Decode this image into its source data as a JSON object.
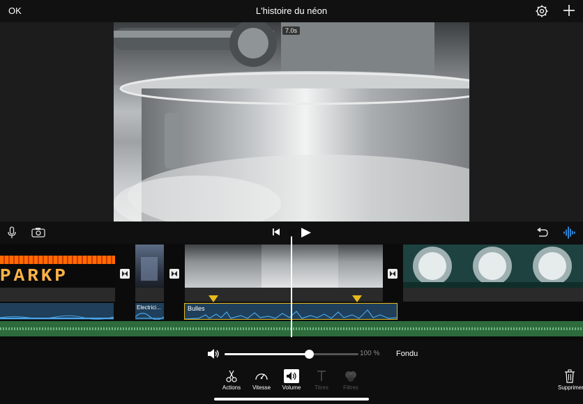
{
  "header": {
    "ok_label": "OK",
    "title": "L'histoire du néon"
  },
  "viewer": {
    "duration_badge": "7.0s"
  },
  "timeline": {
    "clips": [
      {
        "label": "PARKP"
      },
      {
        "label": "Electricité"
      },
      {
        "label": "Bulles"
      }
    ],
    "audio_labels": [
      "Electrici...",
      "Bulles"
    ]
  },
  "controls": {
    "volume_value": 0.63,
    "volume_percent_label": "100 %",
    "fondu_label": "Fondu"
  },
  "toolbar": {
    "items": [
      {
        "label": "Actions",
        "icon": "scissors-icon"
      },
      {
        "label": "Vitesse",
        "icon": "speedometer-icon"
      },
      {
        "label": "Volume",
        "icon": "volume-icon"
      },
      {
        "label": "Titres",
        "icon": "text-icon"
      },
      {
        "label": "Filtres",
        "icon": "filters-icon"
      }
    ],
    "delete_label": "Supprimer"
  },
  "colors": {
    "accent_blue": "#3a9cff",
    "selection_yellow": "#e8b91c",
    "music_green": "#2d6a3c"
  }
}
